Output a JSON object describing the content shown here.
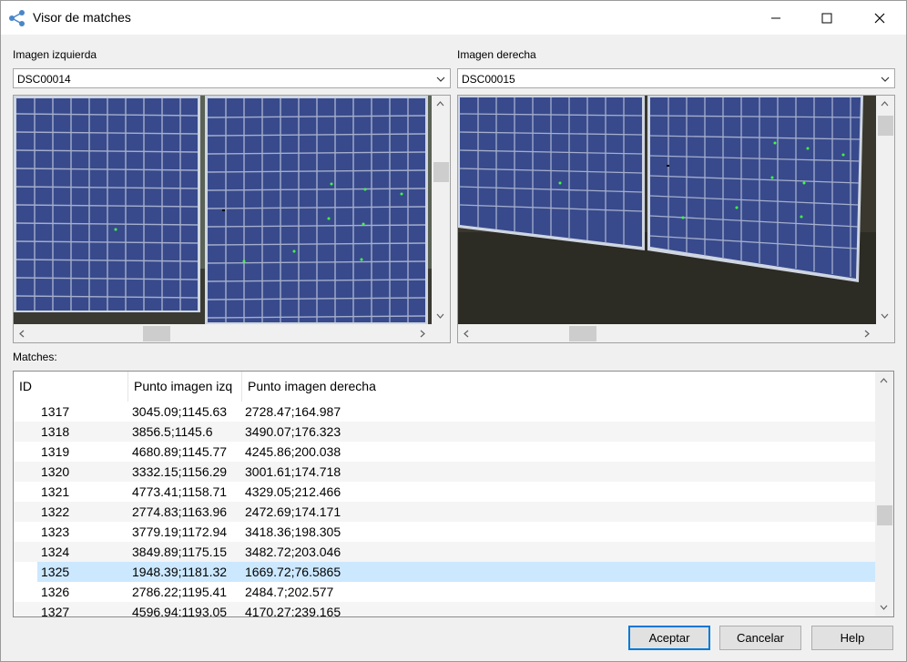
{
  "window": {
    "title": "Visor de matches",
    "minimize_icon": "minimize-icon",
    "maximize_icon": "maximize-icon",
    "close_icon": "close-icon"
  },
  "left_panel": {
    "label": "Imagen izquierda",
    "selected": "DSC00014"
  },
  "right_panel": {
    "label": "Imagen derecha",
    "selected": "DSC00015"
  },
  "matches": {
    "label": "Matches:",
    "columns": [
      "ID",
      "Punto imagen izq",
      "Punto imagen derecha"
    ],
    "rows": [
      {
        "id": "1317",
        "left": "3045.09;1145.63",
        "right": "2728.47;164.987"
      },
      {
        "id": "1318",
        "left": "3856.5;1145.6",
        "right": "3490.07;176.323"
      },
      {
        "id": "1319",
        "left": "4680.89;1145.77",
        "right": "4245.86;200.038"
      },
      {
        "id": "1320",
        "left": "3332.15;1156.29",
        "right": "3001.61;174.718"
      },
      {
        "id": "1321",
        "left": "4773.41;1158.71",
        "right": "4329.05;212.466"
      },
      {
        "id": "1322",
        "left": "2774.83;1163.96",
        "right": "2472.69;174.171"
      },
      {
        "id": "1323",
        "left": "3779.19;1172.94",
        "right": "3418.36;198.305"
      },
      {
        "id": "1324",
        "left": "3849.89;1175.15",
        "right": "3482.72;203.046"
      },
      {
        "id": "1325",
        "left": "1948.39;1181.32",
        "right": "1669.72;76.5865"
      },
      {
        "id": "1326",
        "left": "2786.22;1195.41",
        "right": "2484.7;202.577"
      },
      {
        "id": "1327",
        "left": "4596.94;1193.05",
        "right": "4170.27;239.165"
      }
    ],
    "selected_id": "1325"
  },
  "buttons": {
    "accept": "Aceptar",
    "cancel": "Cancelar",
    "help": "Help"
  },
  "colors": {
    "selection": "#cce8ff",
    "default_button_border": "#0078d7",
    "marker": "#3cff3c"
  }
}
